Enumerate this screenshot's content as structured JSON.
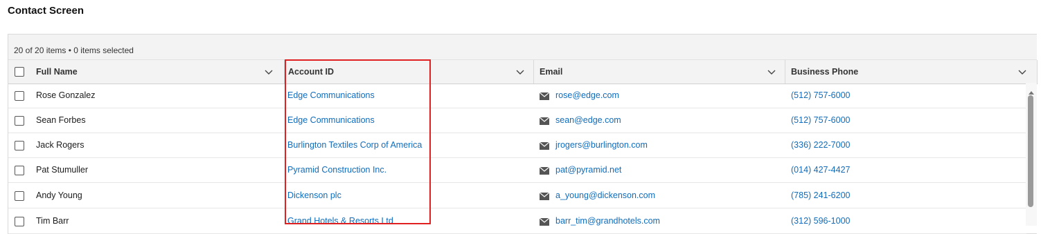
{
  "page": {
    "title": "Contact Screen"
  },
  "grid": {
    "status": "20 of 20 items • 0 items selected",
    "columns": [
      {
        "label": "Full Name"
      },
      {
        "label": "Account ID"
      },
      {
        "label": "Email"
      },
      {
        "label": "Business Phone"
      }
    ],
    "rows": [
      {
        "full_name": "Rose Gonzalez",
        "account": "Edge Communications",
        "email": "rose@edge.com",
        "phone": "(512) 757-6000"
      },
      {
        "full_name": "Sean Forbes",
        "account": "Edge Communications",
        "email": "sean@edge.com",
        "phone": "(512) 757-6000"
      },
      {
        "full_name": "Jack Rogers",
        "account": "Burlington Textiles Corp of America",
        "email": "jrogers@burlington.com",
        "phone": "(336) 222-7000"
      },
      {
        "full_name": "Pat Stumuller",
        "account": "Pyramid Construction Inc.",
        "email": "pat@pyramid.net",
        "phone": "(014) 427-4427"
      },
      {
        "full_name": "Andy Young",
        "account": "Dickenson plc",
        "email": "a_young@dickenson.com",
        "phone": "(785) 241-6200"
      },
      {
        "full_name": "Tim Barr",
        "account": "Grand Hotels & Resorts Ltd",
        "email": "barr_tim@grandhotels.com",
        "phone": "(312) 596-1000"
      }
    ]
  },
  "colors": {
    "link": "#0f6cbd",
    "highlight": "#e02020",
    "header_bg": "#f3f3f3"
  },
  "icons": {
    "email": "mail-icon",
    "sort": "chevron-down-icon"
  }
}
